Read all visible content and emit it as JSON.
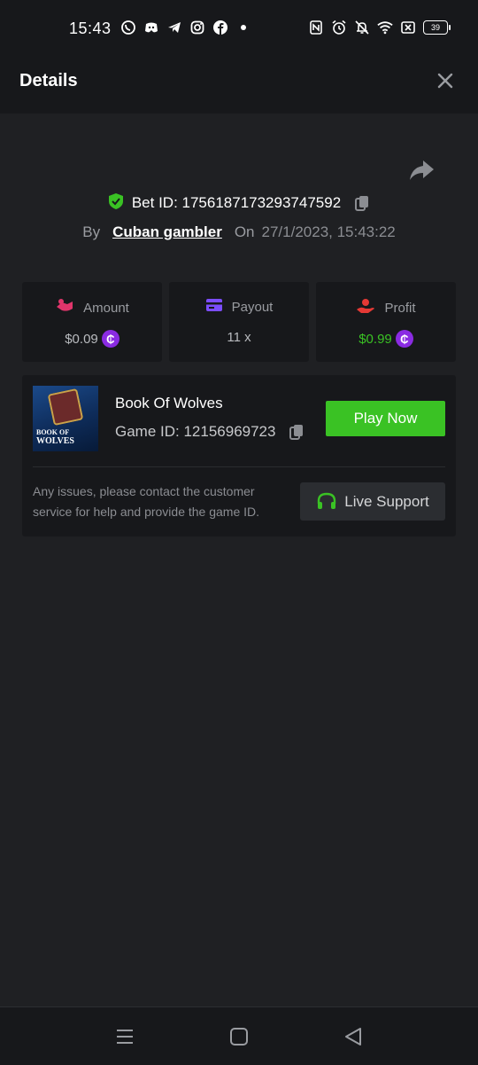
{
  "status_bar": {
    "time": "15:43",
    "left_icons": [
      "whatsapp-icon",
      "discord-icon",
      "telegram-icon",
      "instagram-icon",
      "facebook-icon",
      "dot-icon"
    ],
    "right_icons": [
      "nfc-icon",
      "alarm-icon",
      "mute-icon",
      "wifi-icon",
      "x-box-icon"
    ],
    "battery": "39"
  },
  "header": {
    "title": "Details"
  },
  "bet": {
    "id_label": "Bet ID: 1756187173293747592",
    "by_label": "By",
    "username": "Cuban gambler",
    "on_label": "On",
    "datetime": "27/1/2023, 15:43:22"
  },
  "stats": {
    "amount_label": "Amount",
    "amount_value": "$0.09",
    "payout_label": "Payout",
    "payout_value": "11 x",
    "profit_label": "Profit",
    "profit_value": "$0.99",
    "coin_symbol": "₵"
  },
  "game": {
    "name": "Book Of Wolves",
    "id_label": "Game ID: 12156969723",
    "thumb_text_1": "BOOK OF",
    "thumb_text_2": "WOLVES",
    "play_label": "Play Now"
  },
  "support": {
    "message": "Any issues, please contact the customer service for help and provide the game ID.",
    "button_label": "Live Support"
  },
  "colors": {
    "accent_green": "#3ac224",
    "coin_purple": "#8a2be2",
    "amount_pink": "#e0356b",
    "payout_purple": "#7c4dff",
    "profit_red": "#e53935"
  }
}
